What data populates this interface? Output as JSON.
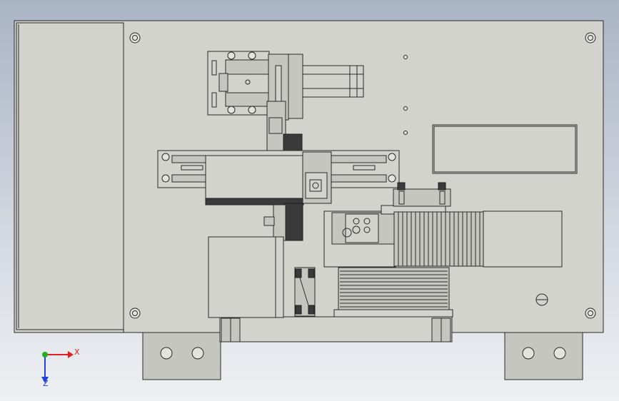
{
  "axis_triad": {
    "x_label": "X",
    "z_label": "Z",
    "x_color": "#e02020",
    "y_color": "#20b020",
    "z_color": "#2040e0"
  },
  "colors": {
    "plate": "#d3d3cd",
    "dark_part": "#3a3a3a",
    "background_top": "#a9b4c5",
    "background_bottom": "#eef0f3"
  }
}
